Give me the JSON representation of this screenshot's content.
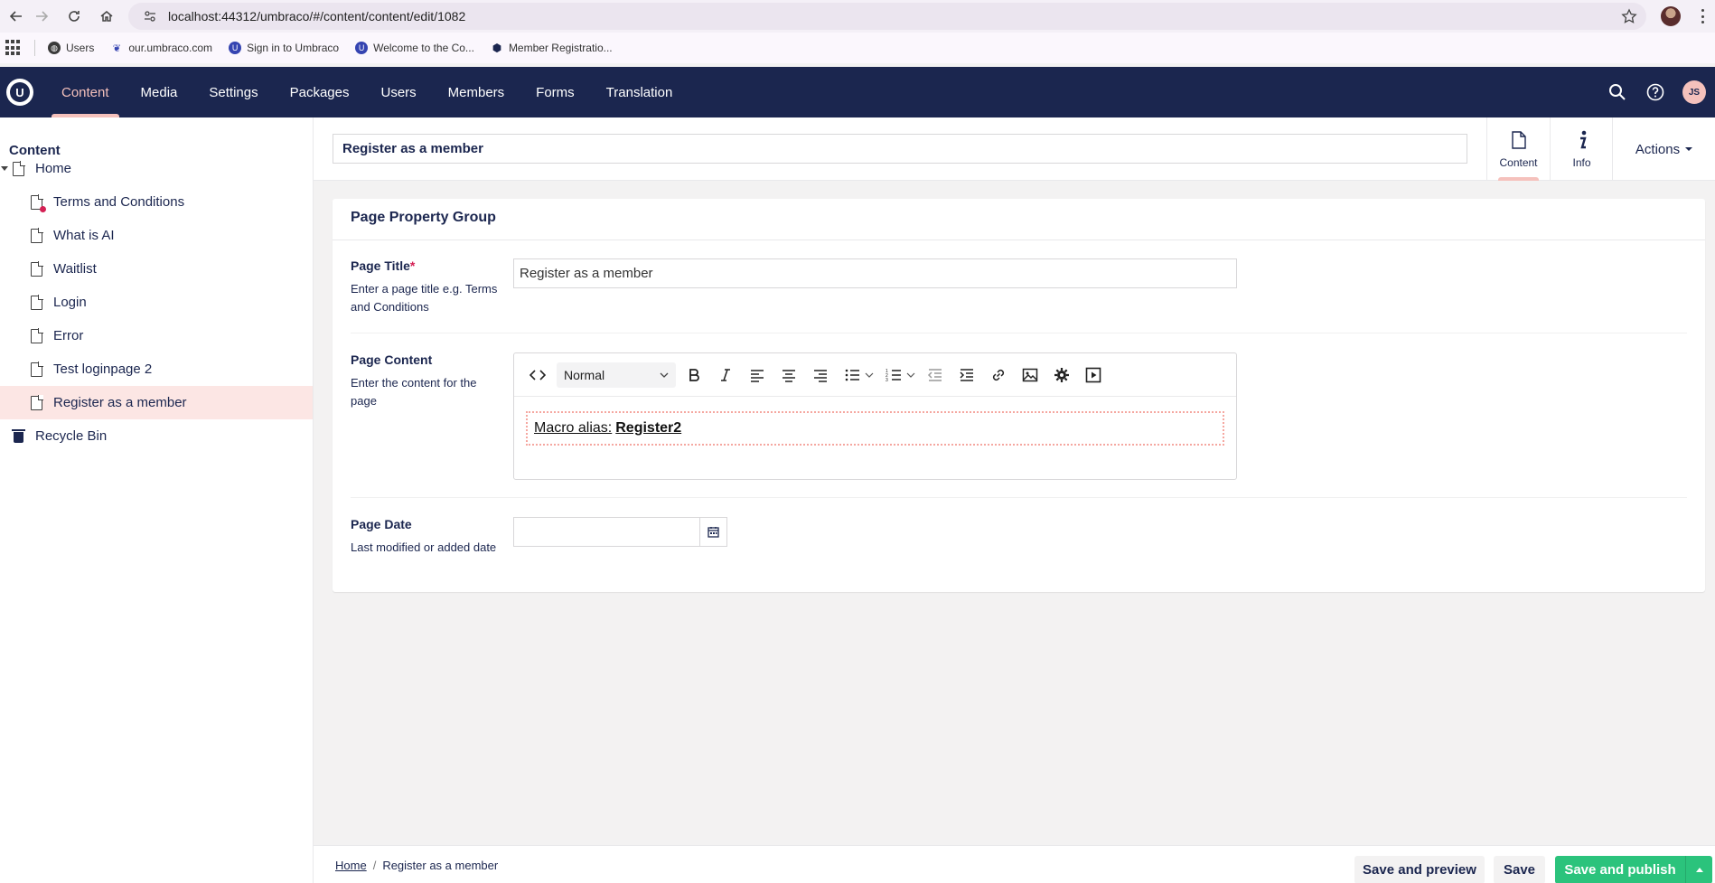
{
  "browser": {
    "url": "localhost:44312/umbraco/#/content/content/edit/1082",
    "bookmarks": [
      {
        "label": "Users",
        "icon": "globe-icon"
      },
      {
        "label": "our.umbraco.com",
        "icon": "umbraco-favicon"
      },
      {
        "label": "Sign in to Umbraco",
        "icon": "umbraco-u-icon"
      },
      {
        "label": "Welcome to the Co...",
        "icon": "umbraco-u-icon"
      },
      {
        "label": "Member Registratio...",
        "icon": "member-icon"
      }
    ]
  },
  "header": {
    "sections": [
      "Content",
      "Media",
      "Settings",
      "Packages",
      "Users",
      "Members",
      "Forms",
      "Translation"
    ],
    "active_section": "Content",
    "user_initials": "JS",
    "colors": {
      "header_bg": "#1b264f",
      "accent": "#f5c1bc",
      "primary": "#2bc37c"
    }
  },
  "tree": {
    "title": "Content",
    "items": [
      {
        "label": "Home",
        "icon": "document-icon"
      },
      {
        "label": "Terms and Conditions",
        "icon": "document-unpublished-icon"
      },
      {
        "label": "What is AI",
        "icon": "document-icon"
      },
      {
        "label": "Waitlist",
        "icon": "document-icon"
      },
      {
        "label": "Login",
        "icon": "document-icon"
      },
      {
        "label": "Error",
        "icon": "document-icon"
      },
      {
        "label": "Test loginpage 2",
        "icon": "document-icon"
      },
      {
        "label": "Register as a member",
        "icon": "document-icon",
        "selected": true
      },
      {
        "label": "Recycle Bin",
        "icon": "trash-icon"
      }
    ]
  },
  "editor": {
    "name_value": "Register as a member",
    "apps": [
      {
        "label": "Content",
        "icon": "document-icon"
      },
      {
        "label": "Info",
        "icon": "info-icon"
      }
    ],
    "actions_label": "Actions",
    "group_title": "Page Property Group",
    "properties": {
      "page_title": {
        "label": "Page Title",
        "required_mark": "*",
        "description": "Enter a page title e.g. Terms and Conditions",
        "value": "Register as a member"
      },
      "page_content": {
        "label": "Page Content",
        "description": "Enter the content for the page",
        "format_select": "Normal",
        "macro_prefix": "Macro alias: ",
        "macro_alias": "Register2"
      },
      "page_date": {
        "label": "Page Date",
        "description": "Last modified or added date",
        "value": ""
      }
    }
  },
  "footer": {
    "breadcrumb": [
      "Home",
      "Register as a member"
    ],
    "save_preview": "Save and preview",
    "save": "Save",
    "save_publish": "Save and publish"
  }
}
